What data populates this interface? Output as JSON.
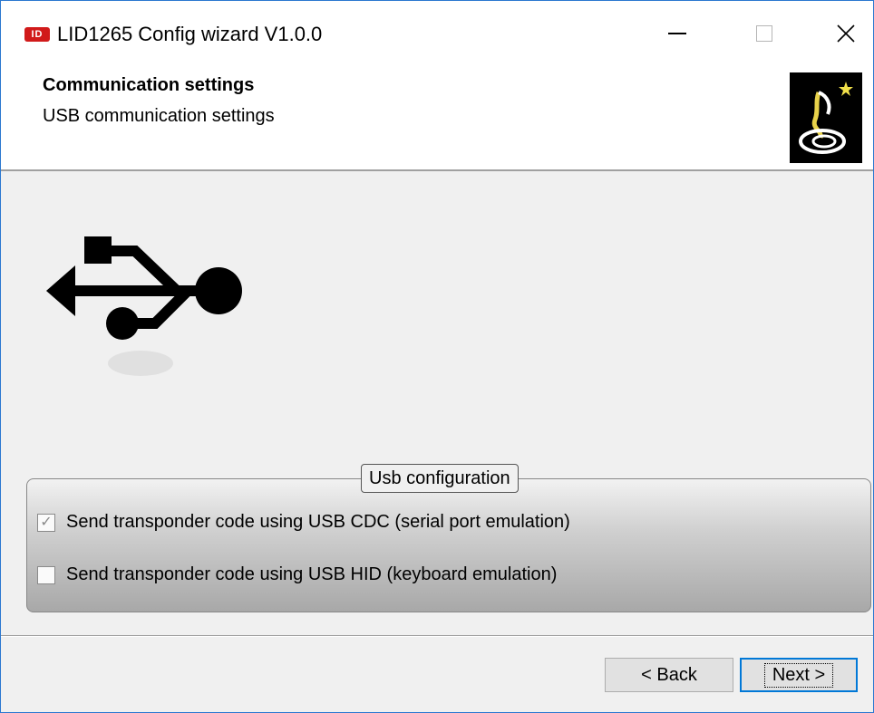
{
  "window": {
    "title": "LID1265 Config wizard V1.0.0",
    "logo_text": "ID",
    "controls": [
      "minimize",
      "maximize",
      "close"
    ]
  },
  "header": {
    "title": "Communication settings",
    "subtitle": "USB communication settings"
  },
  "usb_group": {
    "legend": "Usb configuration",
    "options": [
      {
        "label": "Send transponder code using USB CDC (serial port emulation)",
        "checked": true,
        "enabled": false
      },
      {
        "label": "Send transponder code using USB HID (keyboard emulation)",
        "checked": false,
        "enabled": true
      }
    ]
  },
  "footer": {
    "back_label": "< Back",
    "next_label": "Next >"
  },
  "icons": {
    "usb": "usb-icon",
    "wizard": "wizard-hat-icon",
    "close": "close-icon"
  },
  "colors": {
    "accent": "#0078d7",
    "logo_red": "#d11a1a"
  }
}
